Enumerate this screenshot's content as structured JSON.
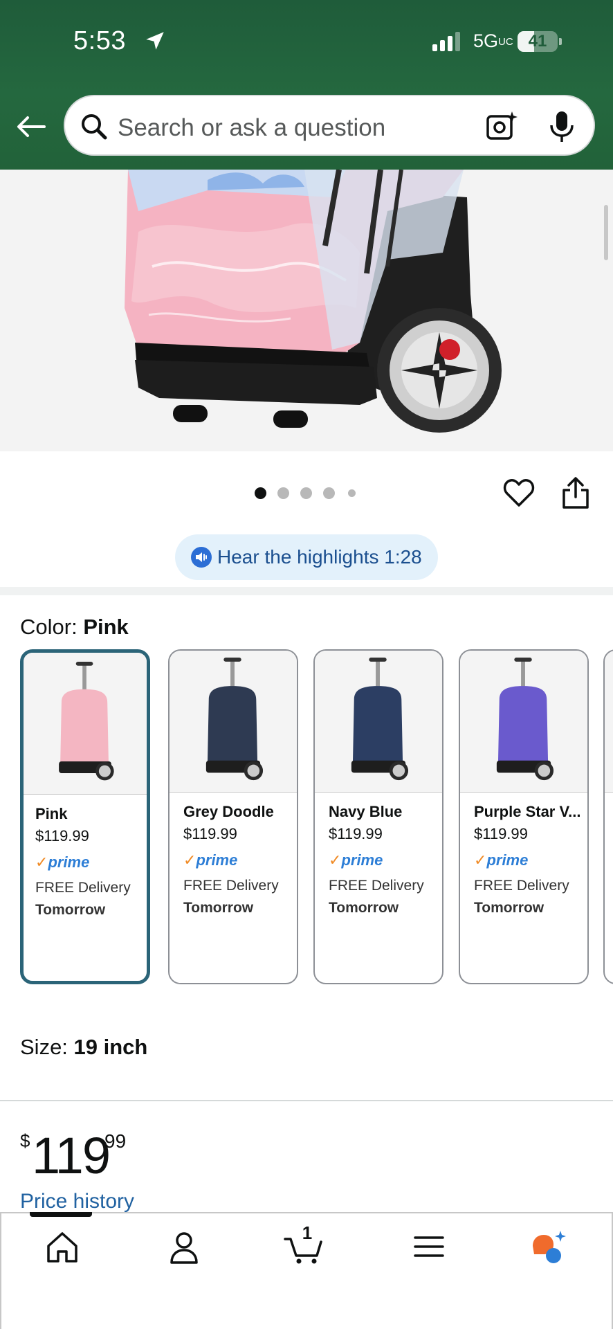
{
  "status_bar": {
    "time": "5:53",
    "network": "5G",
    "network_suffix": "UC",
    "battery": "41"
  },
  "search": {
    "placeholder": "Search or ask a question"
  },
  "gallery": {
    "dot_count": 5,
    "active_dot": 1
  },
  "highlights": {
    "label": "Hear the highlights 1:28"
  },
  "color": {
    "label": "Color: ",
    "value": "Pink"
  },
  "swatches": [
    {
      "name": "Pink",
      "price": "$119.99",
      "prime": "prime",
      "delivery": "FREE Delivery",
      "when": "Tomorrow",
      "selected": true,
      "color": "#f4b6c2"
    },
    {
      "name": "Grey Doodle",
      "price": "$119.99",
      "prime": "prime",
      "delivery": "FREE Delivery",
      "when": "Tomorrow",
      "selected": false,
      "color": "#2e3a52"
    },
    {
      "name": "Navy Blue",
      "price": "$119.99",
      "prime": "prime",
      "delivery": "FREE Delivery",
      "when": "Tomorrow",
      "selected": false,
      "color": "#2c3e63"
    },
    {
      "name": "Purple Star V...",
      "price": "$119.99",
      "prime": "prime",
      "delivery": "FREE Delivery",
      "when": "Tomorrow",
      "selected": false,
      "color": "#6a5acd"
    }
  ],
  "size": {
    "label": "Size: ",
    "value": "19 inch"
  },
  "price": {
    "symbol": "$",
    "whole": "119",
    "fraction": "99",
    "history_link": "Price history"
  },
  "nav": {
    "cart_count": "1"
  },
  "colors": {
    "header": "#24683f",
    "selected_border": "#2b6478",
    "link": "#2162a1",
    "prime": "#2d7ed6"
  }
}
